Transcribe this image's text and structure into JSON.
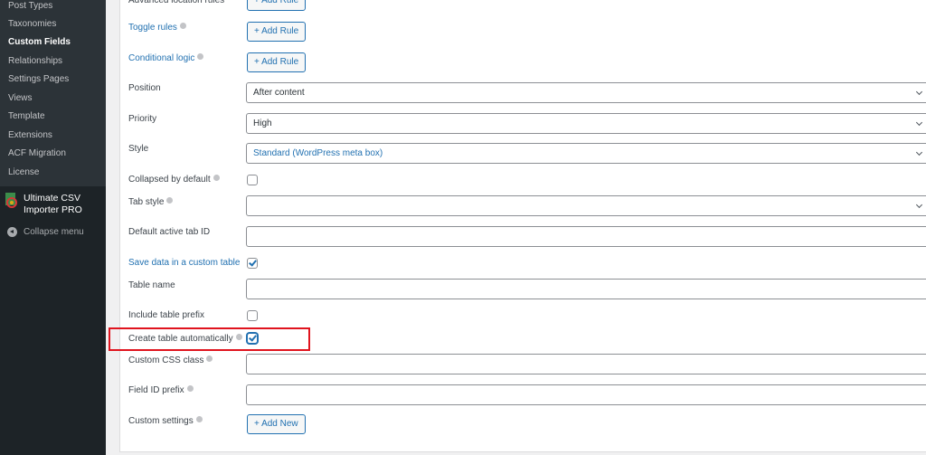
{
  "sidebar": {
    "submenu": [
      {
        "label": "Post Types",
        "current": false
      },
      {
        "label": "Taxonomies",
        "current": false
      },
      {
        "label": "Custom Fields",
        "current": true
      },
      {
        "label": "Relationships",
        "current": false
      },
      {
        "label": "Settings Pages",
        "current": false
      },
      {
        "label": "Views",
        "current": false
      },
      {
        "label": "Template",
        "current": false
      },
      {
        "label": "Extensions",
        "current": false
      },
      {
        "label": "ACF Migration",
        "current": false
      },
      {
        "label": "License",
        "current": false
      }
    ],
    "plugin": {
      "line1": "Ultimate CSV",
      "line2": "Importer PRO",
      "icon": "csv-importer-icon"
    },
    "collapse_label": "Collapse menu"
  },
  "settings": {
    "advanced_location_rules": {
      "label": "Advanced location rules",
      "button": "+ Add Rule"
    },
    "toggle_rules": {
      "label": "Toggle rules",
      "button": "+ Add Rule"
    },
    "conditional_logic": {
      "label": "Conditional logic",
      "button": "+ Add Rule"
    },
    "position": {
      "label": "Position",
      "value": "After content"
    },
    "priority": {
      "label": "Priority",
      "value": "High"
    },
    "style": {
      "label": "Style",
      "value": "Standard (WordPress meta box)"
    },
    "collapsed_by_default": {
      "label": "Collapsed by default",
      "checked": false
    },
    "tab_style": {
      "label": "Tab style",
      "value": ""
    },
    "default_active_tab": {
      "label": "Default active tab ID",
      "value": ""
    },
    "save_custom_table": {
      "label": "Save data in a custom table",
      "checked": true
    },
    "table_name": {
      "label": "Table name",
      "value": ""
    },
    "include_table_prefix": {
      "label": "Include table prefix",
      "checked": false
    },
    "create_table_auto": {
      "label": "Create table automatically",
      "checked": true
    },
    "custom_css_class": {
      "label": "Custom CSS class",
      "value": ""
    },
    "field_id_prefix": {
      "label": "Field ID prefix",
      "value": ""
    },
    "custom_settings": {
      "label": "Custom settings",
      "button": "+ Add New"
    }
  },
  "colors": {
    "accent": "#2271b1",
    "highlight": "#e0141e",
    "sidebar": "#1d2327",
    "submenu": "#2c3338"
  }
}
